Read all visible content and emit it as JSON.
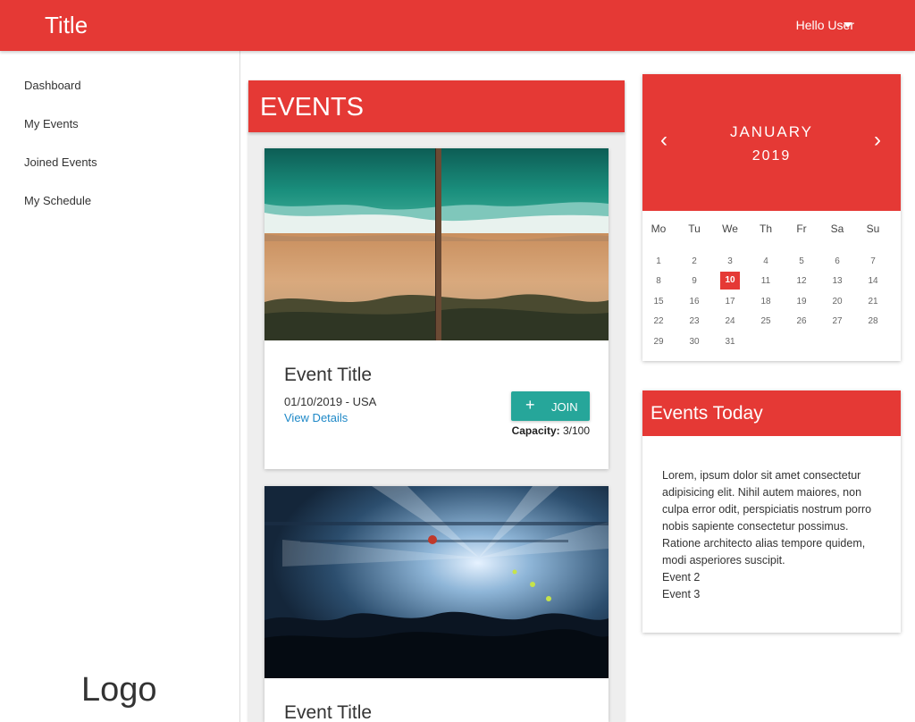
{
  "header": {
    "title": "Title",
    "user_greeting": "Hello User"
  },
  "sidebar": {
    "items": [
      {
        "label": "Dashboard"
      },
      {
        "label": "My Events"
      },
      {
        "label": "Joined Events"
      },
      {
        "label": "My Schedule"
      }
    ],
    "logo_text": "Logo"
  },
  "events": {
    "heading": "EVENTS",
    "cards": [
      {
        "title": "Event Title",
        "meta": "01/10/2019 - USA",
        "link": "View Details",
        "join_label": "JOIN",
        "capacity_label": "Capacity:",
        "capacity_value": "3/100",
        "image": "aerial beach with pier"
      },
      {
        "title": "Event Title",
        "image": "concert crowd with stage lights"
      }
    ]
  },
  "calendar": {
    "month": "JANUARY",
    "year": "2019",
    "weekdays": [
      "Mo",
      "Tu",
      "We",
      "Th",
      "Fr",
      "Sa",
      "Su"
    ],
    "days": [
      "1",
      "2",
      "3",
      "4",
      "5",
      "6",
      "7",
      "8",
      "9",
      "10",
      "11",
      "12",
      "13",
      "14",
      "15",
      "16",
      "17",
      "18",
      "19",
      "20",
      "21",
      "22",
      "23",
      "24",
      "25",
      "26",
      "27",
      "28",
      "29",
      "30",
      "31"
    ],
    "selected_day": "10",
    "prev_icon": "chevron-left-icon",
    "next_icon": "chevron-right-icon"
  },
  "events_today": {
    "heading": "Events Today",
    "text": "Lorem, ipsum dolor sit amet consectetur adipisicing elit. Nihil autem maiores, non culpa error odit, perspiciatis nostrum porro nobis sapiente consectetur possimus. Ratione architecto alias tempore quidem, modi asperiores suscipit.",
    "items": [
      "Event 2",
      "Event 3"
    ]
  },
  "colors": {
    "primary": "#e53935",
    "accent": "#26a69a",
    "link": "#1e88c7"
  }
}
